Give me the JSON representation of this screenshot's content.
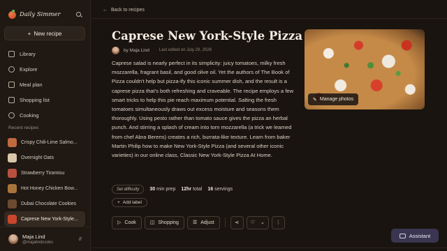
{
  "sidebar": {
    "brand": "Daily Simmer",
    "new_recipe": "New recipe",
    "nav": [
      {
        "label": "Library",
        "icon": "library-icon"
      },
      {
        "label": "Explore",
        "icon": "compass-icon"
      },
      {
        "label": "Meal plan",
        "icon": "calendar-icon"
      },
      {
        "label": "Shopping list",
        "icon": "list-icon"
      },
      {
        "label": "Cooking",
        "icon": "chef-icon"
      }
    ],
    "recent_label": "Recent recipes",
    "recent": [
      {
        "label": "Crispy Chili-Lime Salmo...",
        "color": "#c1693f"
      },
      {
        "label": "Overnight Oats",
        "color": "#d8c7a8"
      },
      {
        "label": "Strawberry Tiramisu",
        "color": "#b8523f"
      },
      {
        "label": "Hot Honey Chicken Bow...",
        "color": "#a8743a"
      },
      {
        "label": "Dubai Chocolate Cookies",
        "color": "#6b4a2f"
      },
      {
        "label": "Caprese New York-Style...",
        "color": "#c9452c"
      }
    ],
    "user": {
      "name": "Maja Lind",
      "handle": "@majalindcooks"
    }
  },
  "main": {
    "back": "Back to recipes",
    "title": "Caprese New York-Style Pizza",
    "author": "by Maja Lind",
    "edited": "Last edited on July 29, 2026",
    "description": "Caprese salad is nearly perfect in its simplicity: juicy tomatoes, milky fresh mozzarella, fragrant basil, and good olive oil. Yet the authors of The Book of Pizza couldn't help but pizza-ify this iconic summer dish, and the result is a caprese pizza that's both refreshing and craveable. The recipe employs a few smart tricks to help this pie reach maximum potential. Salting the fresh tomatoes simultaneously draws out excess moisture and seasons them thoroughly. Using pesto rather than tomato sauce gives the pizza an herbal punch. And stirring a splash of cream into torn mozzarella (a trick we learned from chef Abra Berens) creates a rich, burrata-like texture. Learn from baker Martin Philip how to make New York-Style Pizza (and several other iconic varieties) in our online class, Classic New York-Style Pizza At Home.",
    "manage_photos": "Manage photos",
    "difficulty": "Set difficulty",
    "prep": "30",
    "prep_unit": "min prep",
    "total": "12hr",
    "total_unit": "total",
    "servings": "16",
    "servings_unit": "servings",
    "add_label": "Add label",
    "actions": {
      "cook": "Cook",
      "shopping": "Shopping",
      "adjust": "Adjust"
    },
    "assistant": "Assistant"
  },
  "colors": {
    "background": "#1a1410",
    "sidebar": "#1f1813",
    "assistant": "#3a3550"
  }
}
